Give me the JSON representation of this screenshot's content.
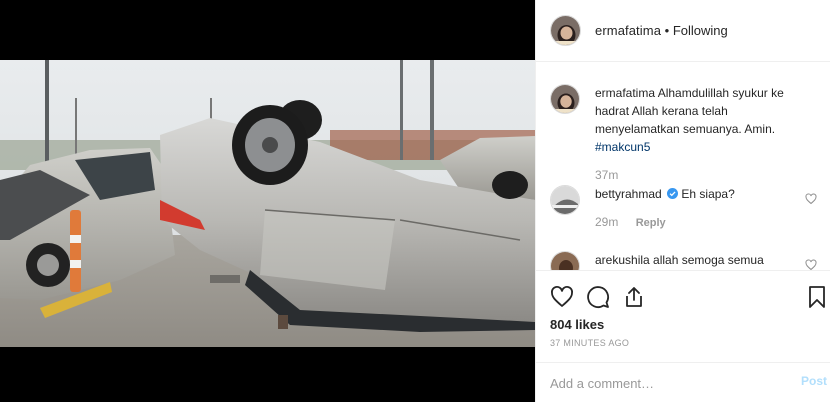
{
  "header": {
    "username": "ermafatima",
    "separator": "•",
    "follow_status": "Following"
  },
  "comments": [
    {
      "username": "ermafatima",
      "text": "Alhamdulillah syukur ke hadrat Allah kerana telah menyelamatkan semuanya. Amin.",
      "hashtag": "#makcun5",
      "time": "37m"
    },
    {
      "username": "bettyrahmad",
      "verified": true,
      "text": "Eh siapa?",
      "time": "29m",
      "reply_label": "Reply"
    },
    {
      "username": "arekushila",
      "text": "allah semoga semua"
    }
  ],
  "actions": {
    "icons": [
      "heart-icon",
      "comment-icon",
      "share-icon",
      "bookmark-icon"
    ],
    "likes": "804 likes",
    "posted": "37 MINUTES AGO"
  },
  "add_comment": {
    "placeholder": "Add a comment…",
    "post_label": "Post"
  },
  "colors": {
    "verified": "#3897f0",
    "hashtag": "#003569",
    "post_disabled": "#b2dffc"
  }
}
